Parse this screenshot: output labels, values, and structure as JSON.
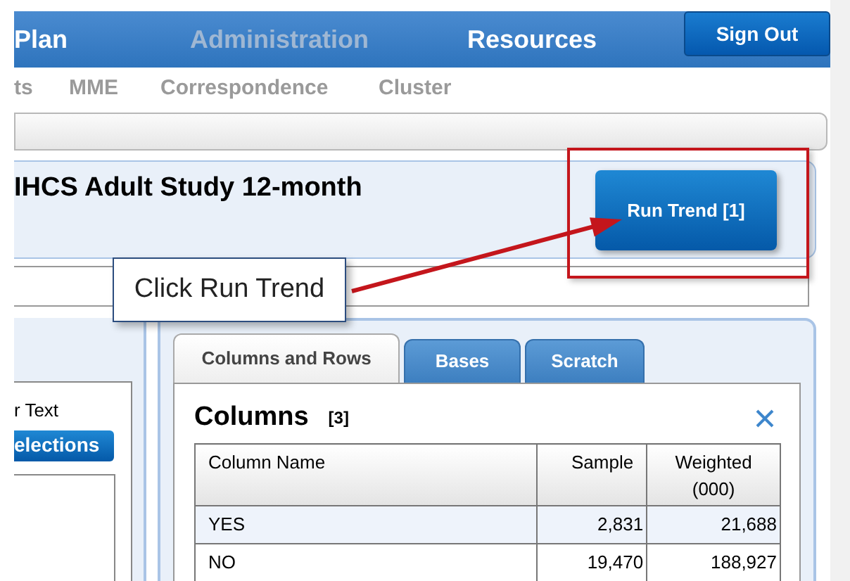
{
  "nav": {
    "items": [
      {
        "label": "Plan",
        "disabled": false
      },
      {
        "label": "Administration",
        "disabled": true
      },
      {
        "label": "Resources",
        "disabled": false
      }
    ],
    "button": "Sign Out"
  },
  "subnav": [
    "ts",
    "MME",
    "Correspondence",
    "Cluster"
  ],
  "study": {
    "title": "IHCS Adult Study 12-month",
    "button": "Run Trend [1]"
  },
  "callout": "Click Run Trend",
  "left_panel": {
    "label": "r Text",
    "button": "elections"
  },
  "tabs": [
    {
      "label": "Columns and Rows",
      "selected": true
    },
    {
      "label": "Bases",
      "selected": false
    },
    {
      "label": "Scratch",
      "selected": false
    }
  ],
  "columns_panel": {
    "title": "Columns",
    "count": "[3]",
    "table": {
      "columns": [
        "Column Name",
        "Sample",
        "Weighted (000)"
      ],
      "rows": [
        [
          "YES",
          "2,831",
          "21,688"
        ],
        [
          "NO",
          "19,470",
          "188,927"
        ]
      ]
    }
  }
}
